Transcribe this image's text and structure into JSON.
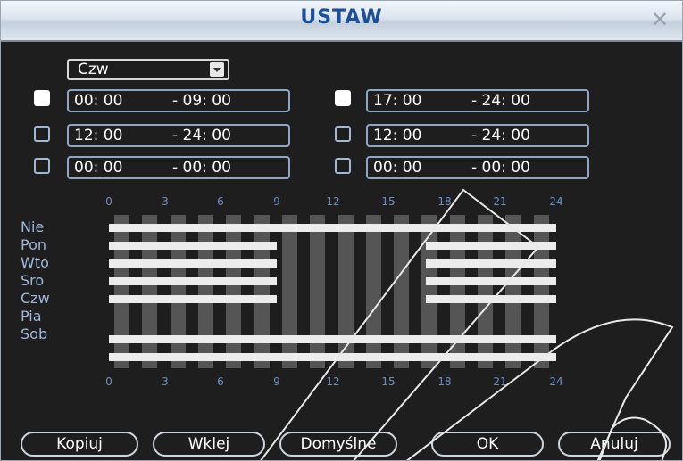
{
  "window": {
    "title": "USTAW"
  },
  "day_select": {
    "value": "Czw"
  },
  "periods": [
    {
      "enabled": true,
      "start": "00: 00",
      "end": "- 09: 00"
    },
    {
      "enabled": true,
      "start": "17: 00",
      "end": "- 24: 00"
    },
    {
      "enabled": false,
      "start": "12: 00",
      "end": "- 24: 00"
    },
    {
      "enabled": false,
      "start": "12: 00",
      "end": "- 24: 00"
    },
    {
      "enabled": false,
      "start": "00: 00",
      "end": "- 00: 00"
    },
    {
      "enabled": false,
      "start": "00: 00",
      "end": "- 00: 00"
    }
  ],
  "schedule": {
    "hour_labels": [
      "0",
      "3",
      "6",
      "9",
      "12",
      "15",
      "18",
      "21",
      "24"
    ],
    "days": [
      {
        "label": "Nie",
        "ranges": [
          [
            0,
            24
          ]
        ]
      },
      {
        "label": "Pon",
        "ranges": [
          [
            0,
            9
          ],
          [
            17,
            24
          ]
        ]
      },
      {
        "label": "Wto",
        "ranges": [
          [
            0,
            9
          ],
          [
            17,
            24
          ]
        ]
      },
      {
        "label": "Sro",
        "ranges": [
          [
            0,
            9
          ],
          [
            17,
            24
          ]
        ]
      },
      {
        "label": "Czw",
        "ranges": [
          [
            0,
            9
          ],
          [
            17,
            24
          ]
        ]
      },
      {
        "label": "Pia",
        "ranges": [
          [
            0,
            24
          ]
        ]
      },
      {
        "label": "Sob",
        "ranges": [
          [
            0,
            24
          ]
        ]
      }
    ]
  },
  "buttons": {
    "copy": "Kopiuj",
    "paste": "Wklej",
    "default": "Domyślne",
    "ok": "OK",
    "cancel": "Anuluj"
  }
}
